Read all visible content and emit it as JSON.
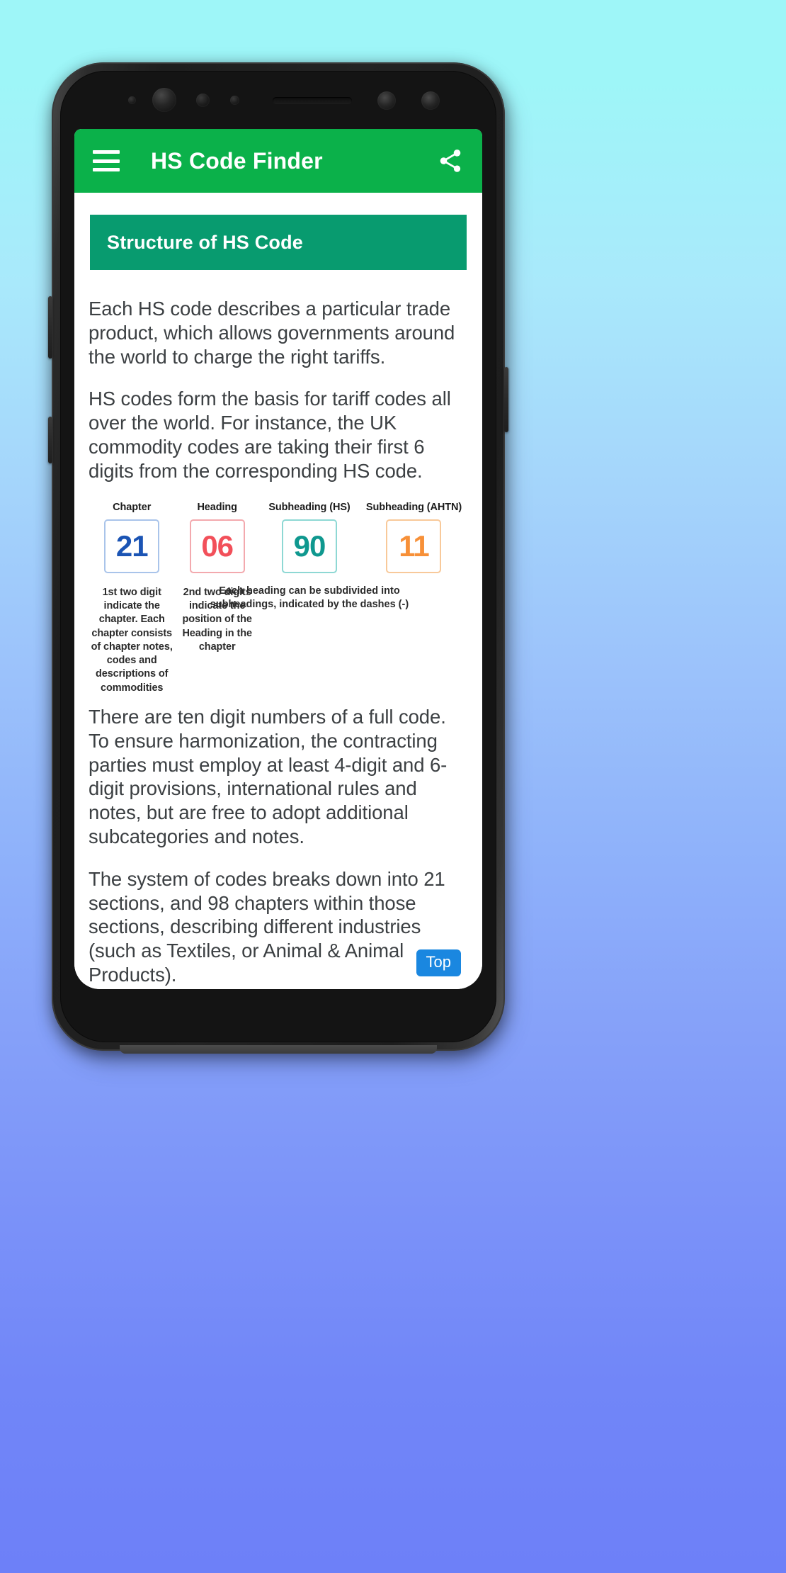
{
  "background": {
    "gradient_top": "#9ef6f8",
    "gradient_bottom": "#6d80f8"
  },
  "appbar": {
    "title": "HS Code Finder",
    "background_color": "#0bb14a",
    "menu_icon": "hamburger-menu-icon",
    "share_icon": "share-icon"
  },
  "section": {
    "banner_title": "Structure of HS Code",
    "banner_color": "#089b6f"
  },
  "paragraphs": {
    "p1": "Each HS code describes a particular trade product, which allows governments around the world to charge the right tariffs.",
    "p2": "HS codes form the basis for tariff codes all over the world. For instance, the UK commodity codes are taking their first 6 digits from the corresponding HS code.",
    "p3": "There are ten digit numbers of a full code. To ensure harmonization, the contracting parties must employ at least 4-digit and 6-digit provisions, international rules and notes, but are free to adopt additional subcategories and notes.",
    "p4": "The system of codes breaks down into 21 sections, and 98 chapters within those sections, describing different industries (such as Textiles, or Animal & Animal Products)."
  },
  "diagram": {
    "columns": [
      {
        "label": "Chapter",
        "digits": "21",
        "color": "#1b54b4",
        "border_color": "#a9c4ea",
        "caption": "1st two digit indicate the chapter. Each chapter consists of chapter notes, codes and descriptions of commodities"
      },
      {
        "label": "Heading",
        "digits": "06",
        "color": "#f2505a",
        "border_color": "#f3a9ae",
        "caption": "2nd two digits indicate the position of the Heading in the chapter"
      },
      {
        "label": "Subheading (HS)",
        "digits": "90",
        "color": "#0f988f",
        "border_color": "#8ed8d4",
        "caption": ""
      },
      {
        "label": "Subheading (AHTN)",
        "digits": "11",
        "color": "#f79038",
        "border_color": "#f8c99a",
        "caption": ""
      }
    ],
    "shared_caption": "Each heading can be subdivided into subheadings, indicated by the dashes (-)"
  },
  "top_button": {
    "label": "Top",
    "color": "#1a87e0"
  }
}
